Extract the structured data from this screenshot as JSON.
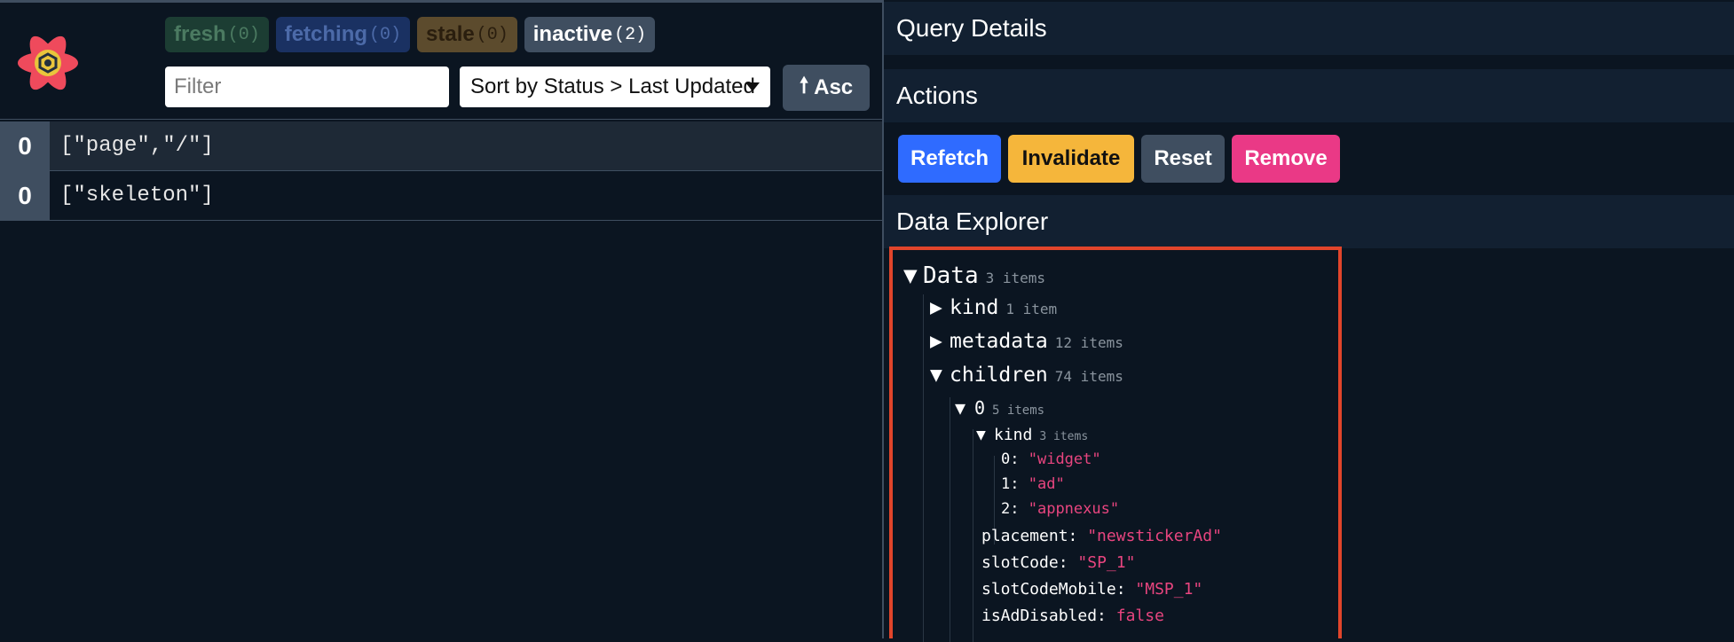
{
  "filters": {
    "fresh": {
      "label": "fresh",
      "count": "(0)"
    },
    "fetching": {
      "label": "fetching",
      "count": "(0)"
    },
    "stale": {
      "label": "stale",
      "count": "(0)"
    },
    "inactive": {
      "label": "inactive",
      "count": "(2)"
    }
  },
  "search": {
    "placeholder": "Filter",
    "value": ""
  },
  "sort": {
    "selected": "Sort by Status > Last Updated"
  },
  "order": {
    "label": "Asc",
    "arrow": "🠕"
  },
  "queries": [
    {
      "observers": "0",
      "key": "[\"page\",\"/\"]"
    },
    {
      "observers": "0",
      "key": "[\"skeleton\"]"
    }
  ],
  "details": {
    "query_details_title": "Query Details",
    "actions_title": "Actions",
    "buttons": {
      "refetch": "Refetch",
      "invalidate": "Invalidate",
      "reset": "Reset",
      "remove": "Remove"
    },
    "data_explorer_title": "Data Explorer"
  },
  "explorer": {
    "root": {
      "toggle": "▼",
      "label": "Data",
      "meta": "3 items"
    },
    "kind": {
      "toggle": "▶",
      "label": "kind",
      "meta": "1 item"
    },
    "metadata": {
      "toggle": "▶",
      "label": "metadata",
      "meta": "12 items"
    },
    "children": {
      "toggle": "▼",
      "label": "children",
      "meta": "74 items"
    },
    "child0": {
      "toggle": "▼",
      "label": "0",
      "meta": "5 items"
    },
    "child0_kind": {
      "toggle": "▼",
      "label": "kind",
      "meta": "3 items"
    },
    "kind_values": [
      {
        "key": "0:",
        "value": "\"widget\""
      },
      {
        "key": "1:",
        "value": "\"ad\""
      },
      {
        "key": "2:",
        "value": "\"appnexus\""
      }
    ],
    "props": [
      {
        "key": "placement:",
        "value": "\"newstickerAd\""
      },
      {
        "key": "slotCode:",
        "value": "\"SP_1\""
      },
      {
        "key": "slotCodeMobile:",
        "value": "\"MSP_1\""
      },
      {
        "key": "isAdDisabled:",
        "value": "false"
      }
    ]
  },
  "colors": {
    "background": "#0b1521",
    "panel": "#122031",
    "gray": "#3f4e60",
    "refetch": "#2f6bff",
    "invalidate": "#f5b63b",
    "remove": "#ea3986",
    "string_value": "#e8457f",
    "highlight_border": "#e1452b"
  }
}
